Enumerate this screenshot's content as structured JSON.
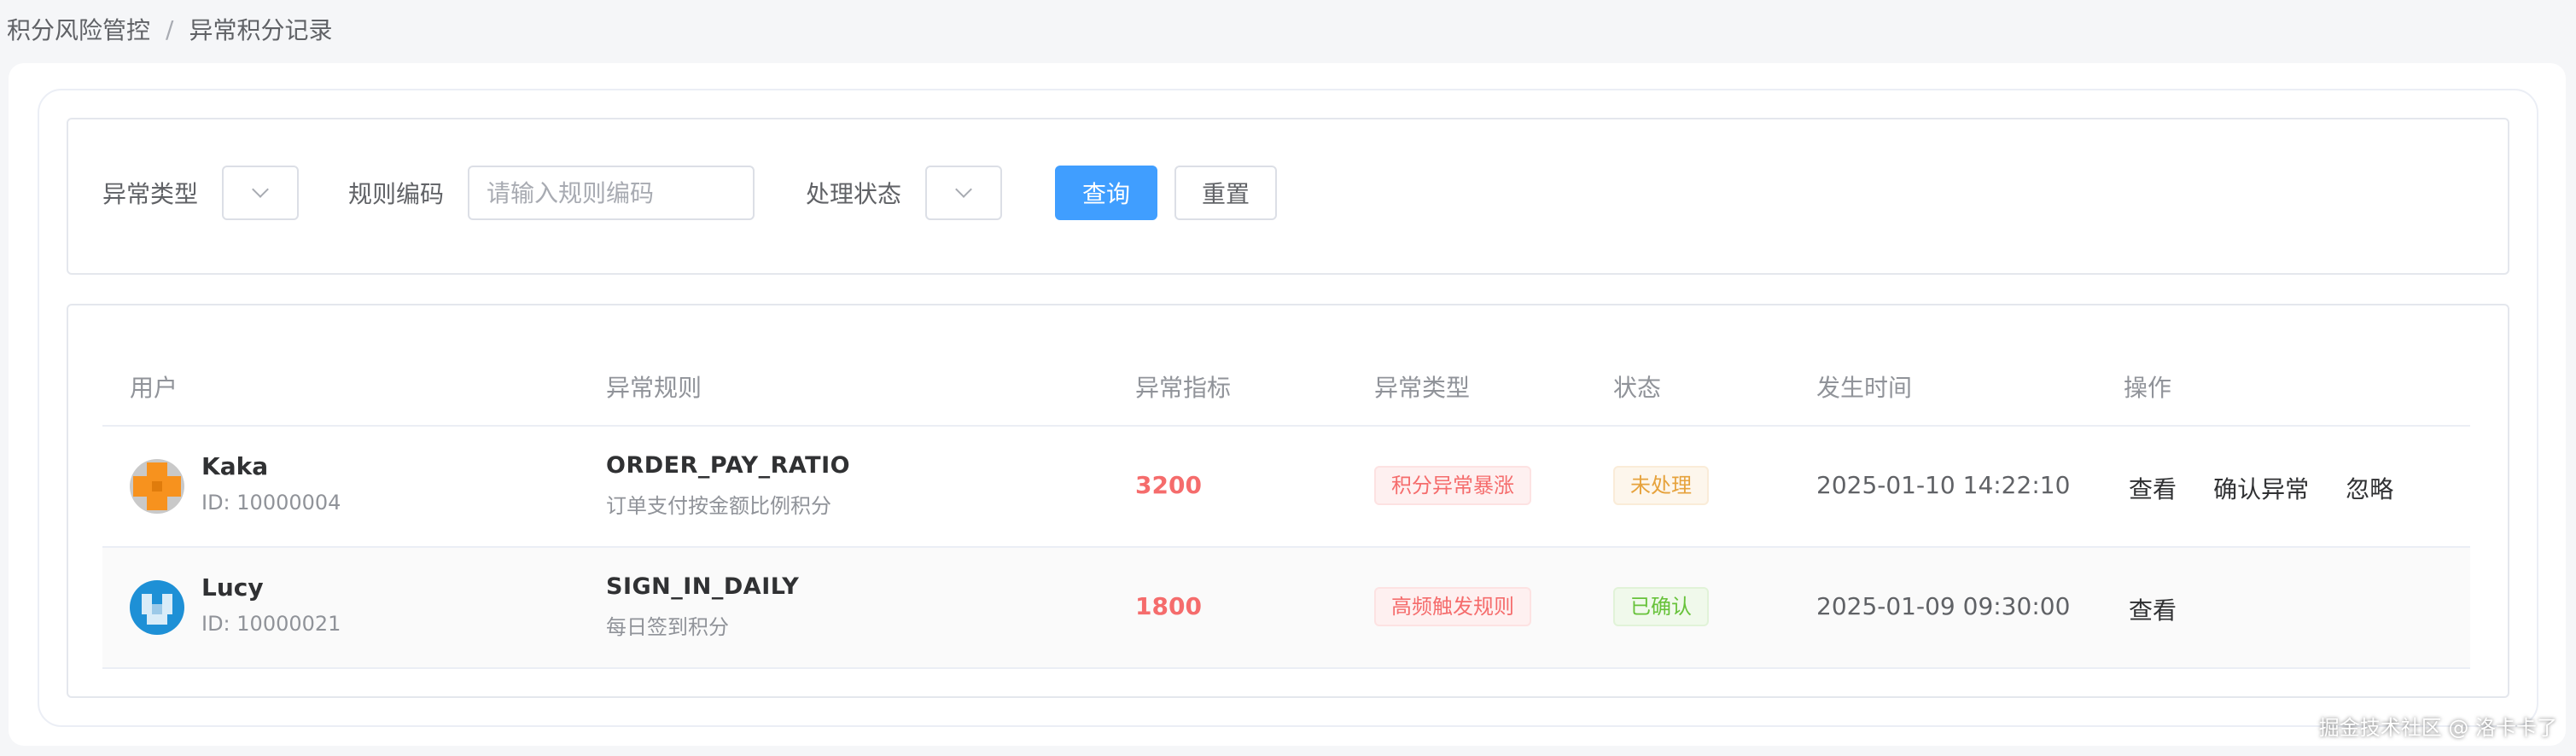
{
  "breadcrumb": {
    "parent": "积分风险管控",
    "separator": "/",
    "current": "异常积分记录"
  },
  "filters": {
    "anomaly_type_label": "异常类型",
    "rule_code_label": "规则编码",
    "rule_code_placeholder": "请输入规则编码",
    "rule_code_value": "",
    "status_label": "处理状态",
    "query_button": "查询",
    "reset_button": "重置"
  },
  "table": {
    "columns": [
      "用户",
      "异常规则",
      "异常指标",
      "异常类型",
      "状态",
      "发生时间",
      "操作"
    ],
    "rows": [
      {
        "avatar_color": "#f7921e",
        "name": "Kaka",
        "id": "ID: 10000004",
        "rule_code": "ORDER_PAY_RATIO",
        "rule_desc": "订单支付按金额比例积分",
        "metric": "3200",
        "type": "积分异常暴涨",
        "status": "未处理",
        "status_kind": "warning",
        "time": "2025-01-10 14:22:10",
        "actions": [
          "查看",
          "确认异常",
          "忽略"
        ]
      },
      {
        "avatar_color": "#1e90d6",
        "name": "Lucy",
        "id": "ID: 10000021",
        "rule_code": "SIGN_IN_DAILY",
        "rule_desc": "每日签到积分",
        "metric": "1800",
        "type": "高频触发规则",
        "status": "已确认",
        "status_kind": "success",
        "time": "2025-01-09 09:30:00",
        "actions": [
          "查看"
        ]
      }
    ]
  },
  "watermark": "掘金技术社区 @ 洛卡卡了"
}
